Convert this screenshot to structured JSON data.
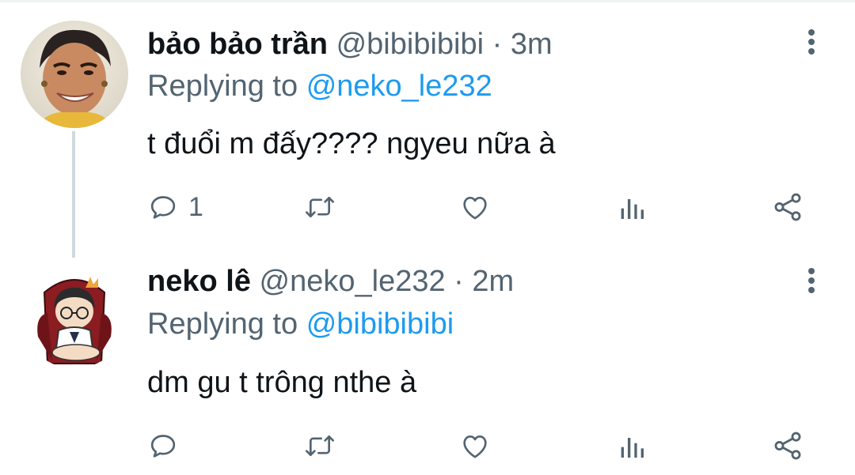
{
  "tweets": [
    {
      "display_name": "bảo bảo trần",
      "handle": "@bibibibibi",
      "separator": "·",
      "time": "3m",
      "replying_label": "Replying to",
      "replying_to": "@neko_le232",
      "text": "t đuổi m đấy???? ngyeu nữa à",
      "reply_count": "1",
      "icons": [
        "more-vertical-icon",
        "reply-icon",
        "retweet-icon",
        "like-icon",
        "analytics-icon",
        "share-icon"
      ]
    },
    {
      "display_name": "neko lê",
      "handle": "@neko_le232",
      "separator": "·",
      "time": "2m",
      "replying_label": "Replying to",
      "replying_to": "@bibibibibi",
      "text": "dm gu t trông nthe à",
      "reply_count": "",
      "icons": [
        "more-vertical-icon",
        "reply-icon",
        "retweet-icon",
        "like-icon",
        "analytics-icon",
        "share-icon"
      ]
    }
  ],
  "colors": {
    "text": "#0f1419",
    "secondary": "#536471",
    "link": "#1d9bf0",
    "thread_line": "#cfd9de"
  }
}
